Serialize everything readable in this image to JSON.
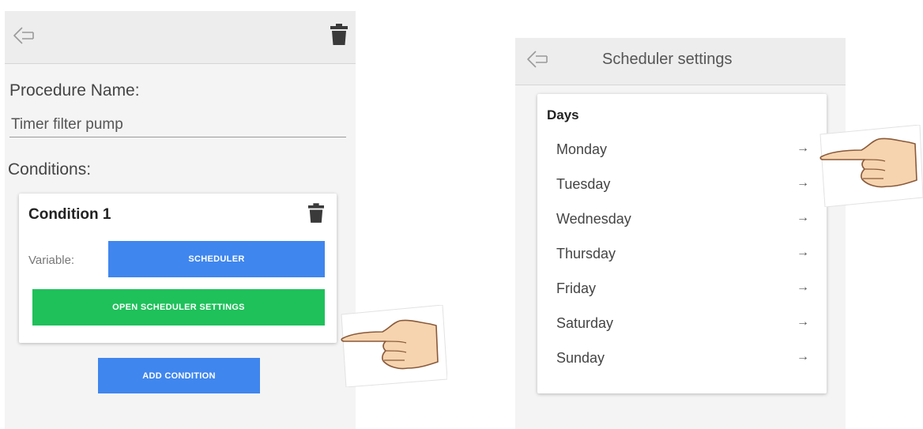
{
  "left_screen": {
    "procedure_label": "Procedure Name:",
    "procedure_value": "Timer filter pump",
    "conditions_label": "Conditions:",
    "condition_card": {
      "title": "Condition 1",
      "variable_label": "Variable:",
      "variable_button": "SCHEDULER",
      "open_settings_button": "OPEN SCHEDULER SETTINGS"
    },
    "add_condition_button": "ADD CONDITION"
  },
  "right_screen": {
    "title": "Scheduler settings",
    "days_title": "Days",
    "days": [
      {
        "label": "Monday",
        "arrow": "→"
      },
      {
        "label": "Tuesday",
        "arrow": "→"
      },
      {
        "label": "Wednesday",
        "arrow": "→"
      },
      {
        "label": "Thursday",
        "arrow": "→"
      },
      {
        "label": "Friday",
        "arrow": "→"
      },
      {
        "label": "Saturday",
        "arrow": "→"
      },
      {
        "label": "Sunday",
        "arrow": "→"
      }
    ]
  },
  "icons": {
    "back": "back-arrow-icon",
    "delete": "trash-icon",
    "pointer": "pointing-hand-icon"
  },
  "colors": {
    "primary_blue": "#3f86ee",
    "success_green": "#1ec15a",
    "background": "#f4f4f4",
    "topbar": "#ededed"
  }
}
